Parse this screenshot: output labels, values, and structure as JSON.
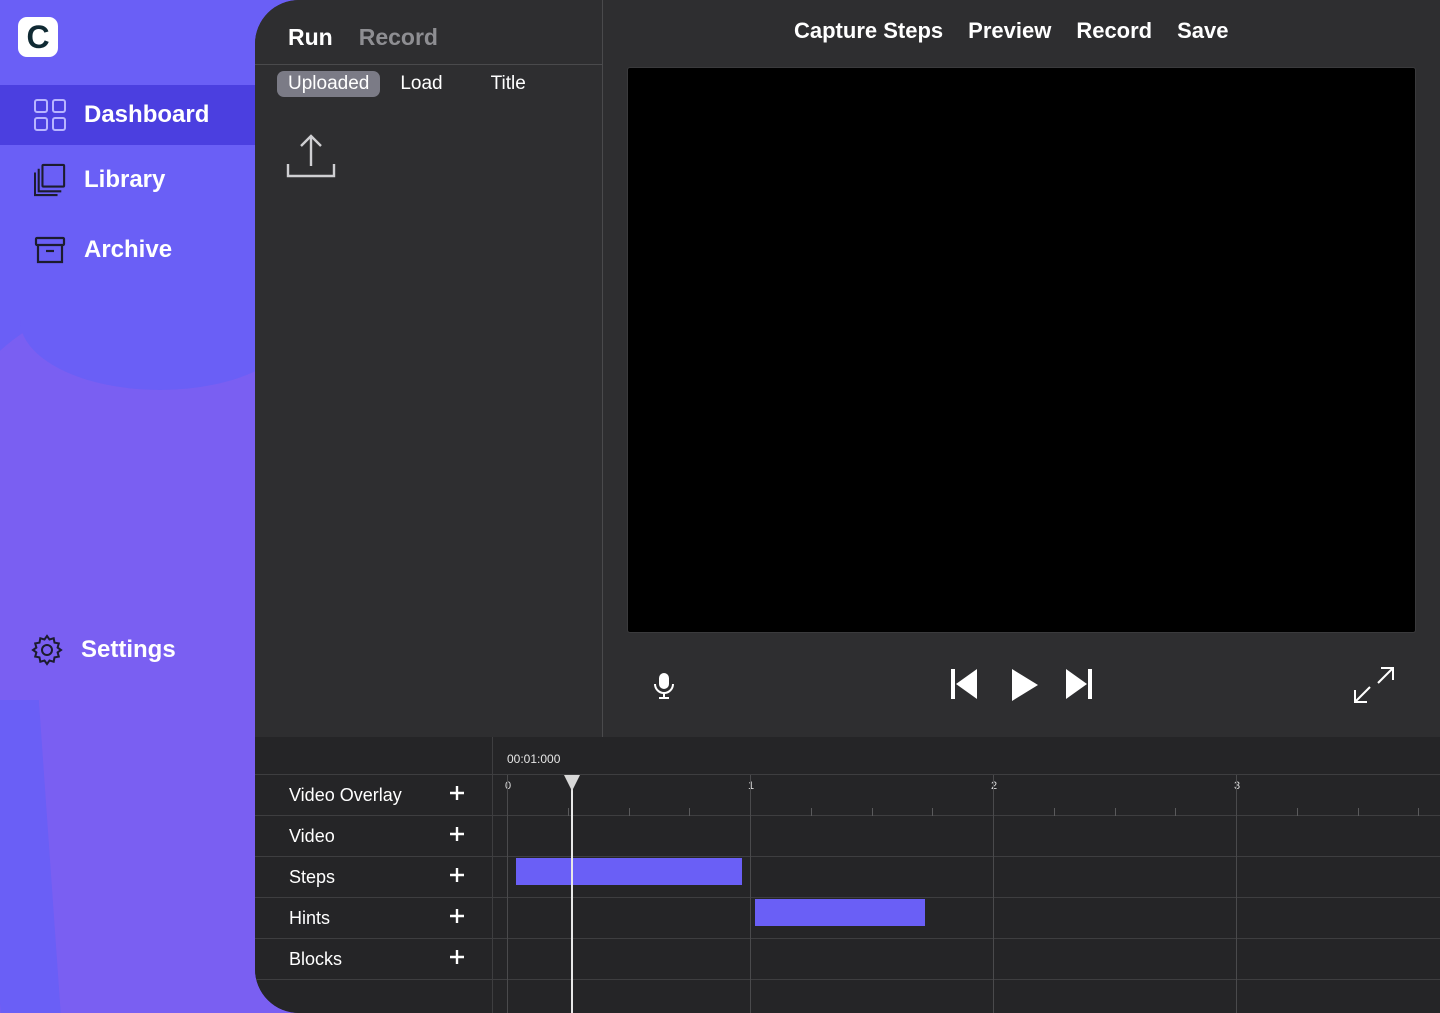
{
  "app": {
    "logo_letter": "C",
    "accent": "#6a5ff6"
  },
  "sidebar": {
    "items": [
      {
        "label": "Dashboard",
        "icon": "grid-icon"
      },
      {
        "label": "Library",
        "icon": "library-icon"
      },
      {
        "label": "Archive",
        "icon": "archive-icon"
      }
    ],
    "settings": {
      "label": "Settings",
      "icon": "gear-icon"
    }
  },
  "left_panel": {
    "tabs": {
      "run": "Run",
      "record": "Record"
    },
    "subtabs": {
      "uploaded": "Uploaded",
      "load": "Load",
      "title": "Title"
    }
  },
  "topmenu": {
    "capture_steps": "Capture Steps",
    "preview": "Preview",
    "record": "Record",
    "save": "Save"
  },
  "timeline": {
    "time_readout": "00:01:000",
    "ruler": [
      "0",
      "1",
      "2",
      "3"
    ],
    "rows": [
      {
        "label": "Video Overlay"
      },
      {
        "label": "Video"
      },
      {
        "label": "Steps"
      },
      {
        "label": "Hints"
      },
      {
        "label": "Blocks"
      }
    ]
  }
}
